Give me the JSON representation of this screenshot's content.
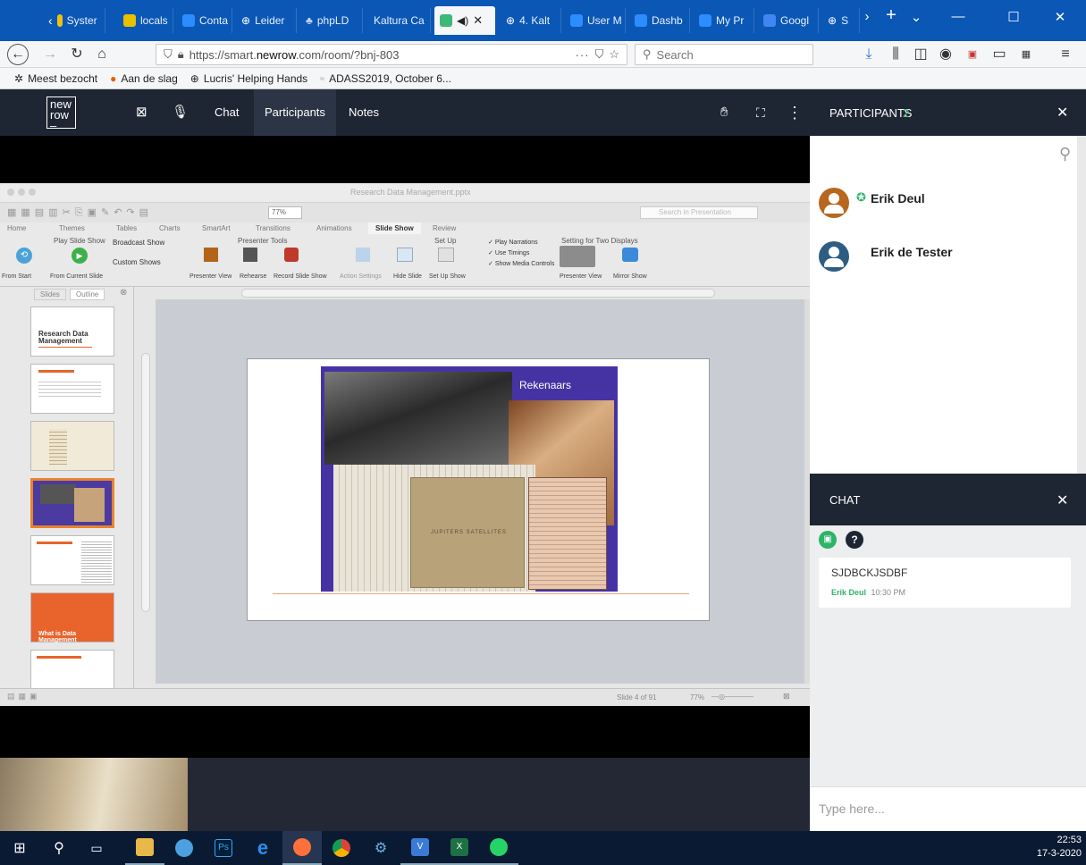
{
  "browser": {
    "tabs": [
      {
        "label": "Syster",
        "color": "#f0c010"
      },
      {
        "label": "locals",
        "color": "#e8c000"
      },
      {
        "label": "Conta",
        "color": "#2d8cff"
      },
      {
        "label": "Leider",
        "color": "#ffffff"
      },
      {
        "label": "phpLD",
        "color": "#6c7eb7"
      },
      {
        "label": "Kaltura Ca",
        "color": "#ffffff"
      },
      {
        "label": "",
        "color": "#3cb878"
      },
      {
        "label": "4. Kalt",
        "color": "#ffffff"
      },
      {
        "label": "User M",
        "color": "#2d8cff"
      },
      {
        "label": "Dashb",
        "color": "#2d8cff"
      },
      {
        "label": "My Pr",
        "color": "#2d8cff"
      },
      {
        "label": "Googl",
        "color": "#4285f4"
      },
      {
        "label": "S",
        "color": "#ffffff"
      }
    ],
    "url_prefix": "https://smart.",
    "url_host": "newrow",
    "url_suffix": ".com/room/?bnj-803",
    "search_placeholder": "Search",
    "bookmarks": [
      "Meest bezocht",
      "Aan de slag",
      "Lucris' Helping Hands",
      "ADASS2019, October 6..."
    ]
  },
  "appbar": {
    "logo_line1": "new",
    "logo_line2": "row",
    "logo_line3": "–",
    "nav": [
      "Chat",
      "Participants",
      "Notes"
    ],
    "selected": "Participants"
  },
  "participants": {
    "title": "PARTICIPANTS",
    "count": "2",
    "people": [
      {
        "name": "Erik Deul",
        "host": true
      },
      {
        "name": "Erik de Tester",
        "host": false
      }
    ]
  },
  "chat": {
    "title": "CHAT",
    "messages": [
      {
        "text": "SJDBCKJSDBF",
        "author": "Erik Deul",
        "time": "10:30 PM"
      }
    ],
    "input_placeholder": "Type here..."
  },
  "ppt": {
    "window_title": "Research Data Management.pptx",
    "ribbon_tabs": [
      "Home",
      "Themes",
      "Tables",
      "Charts",
      "SmartArt",
      "Transitions",
      "Animations",
      "Slide Show",
      "Review"
    ],
    "active_ribbon_tab": "Slide Show",
    "zoom": "77%",
    "search_placeholder": "Search in Presentation",
    "groups": [
      "Play Slide Show",
      "Presenter Tools",
      "Set Up",
      "Setting for Two Displays"
    ],
    "buttons": [
      "From Start",
      "From Current Slide",
      "Broadcast Show",
      "Custom Shows",
      "Presenter View",
      "Rehearse",
      "Record Slide Show",
      "Action Settings",
      "Hide Slide",
      "Set Up Show",
      "Presenter View",
      "Mirror Show"
    ],
    "checks": [
      "Play Narrations",
      "Use Timings",
      "Show Media Controls"
    ],
    "pane_tabs": [
      "Slides",
      "Outline"
    ],
    "thumb1_title": "Research Data Management",
    "thumb6_title": "What is Data Management",
    "slide_title": "Rekenaars",
    "book_title": "JUPITERS SATELLITES",
    "status": "Slide 4 of 91",
    "status_zoom": "77%"
  },
  "taskbar": {
    "time": "22:53",
    "date": "17-3-2020"
  }
}
